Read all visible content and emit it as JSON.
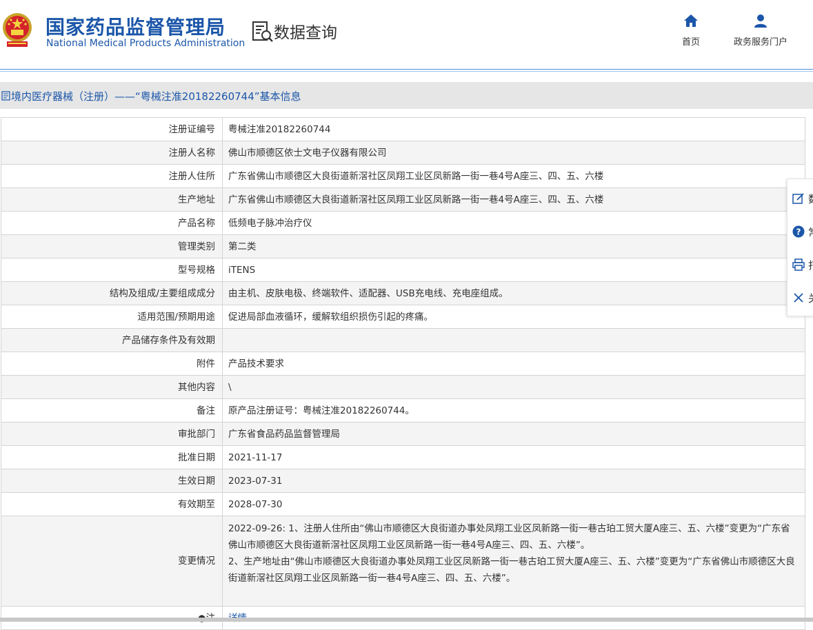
{
  "header": {
    "agency_cn": "国家药品监督管理局",
    "agency_en": "National Medical Products Administration",
    "section_title": "数据查询",
    "nav": [
      {
        "label": "首页",
        "icon": "home-icon"
      },
      {
        "label": "政务服务门户",
        "icon": "user-icon"
      }
    ]
  },
  "page_title": "境内医疗器械（注册）——“粤械注准20182260744”基本信息",
  "rows": [
    {
      "label": "注册证编号",
      "value": "粤械注准20182260744"
    },
    {
      "label": "注册人名称",
      "value": "佛山市顺德区依士文电子仪器有限公司"
    },
    {
      "label": "注册人住所",
      "value": "广东省佛山市顺德区大良街道新滘社区凤翔工业区凤新路一街一巷4号A座三、四、五、六楼"
    },
    {
      "label": "生产地址",
      "value": "广东省佛山市顺德区大良街道新滘社区凤翔工业区凤新路一街一巷4号A座三、四、五、六楼"
    },
    {
      "label": "产品名称",
      "value": "低频电子脉冲治疗仪"
    },
    {
      "label": "管理类别",
      "value": "第二类"
    },
    {
      "label": "型号规格",
      "value": "iTENS"
    },
    {
      "label": "结构及组成/主要组成成分",
      "value": "由主机、皮肤电极、终端软件、适配器、USB充电线、充电座组成。"
    },
    {
      "label": "适用范围/预期用途",
      "value": "促进局部血液循环，缓解软组织损伤引起的疼痛。"
    },
    {
      "label": "产品储存条件及有效期",
      "value": ""
    },
    {
      "label": "附件",
      "value": "产品技术要求"
    },
    {
      "label": "其他内容",
      "value": "\\"
    },
    {
      "label": "备注",
      "value": "原产品注册证号：粤械注准20182260744。"
    },
    {
      "label": "审批部门",
      "value": "广东省食品药品监督管理局"
    },
    {
      "label": "批准日期",
      "value": "2021-11-17"
    },
    {
      "label": "生效日期",
      "value": "2023-07-31"
    },
    {
      "label": "有效期至",
      "value": "2028-07-30"
    }
  ],
  "change": {
    "label": "变更情况",
    "line1": "2022-09-26: 1、注册人住所由“佛山市顺德区大良街道办事处凤翔工业区凤新路一街一巷古珀工贸大厦A座三、五、六楼”变更为“广东省佛山市顺德区大良街道新滘社区凤翔工业区凤新路一街一巷4号A座三、四、五、六楼”。",
    "line2": "2、生产地址由“佛山市顺德区大良街道办事处凤翔工业区凤新路一街一巷古珀工贸大厦A座三、五、六楼”变更为“广东省佛山市顺德区大良街道新滘社区凤翔工业区凤新路一街一巷4号A座三、四、五、六楼”。"
  },
  "last_row": {
    "label": "●注",
    "value": "详情"
  },
  "sidebar": [
    {
      "label": "数",
      "icon": "edit-icon"
    },
    {
      "label": "常",
      "icon": "help-icon"
    },
    {
      "label": "打",
      "icon": "print-icon"
    },
    {
      "label": "关",
      "icon": "close-icon"
    }
  ],
  "colors": {
    "brand_blue": "#1b56a9",
    "title_bar": "#e6e6e6",
    "row_alt": "#f4f4f4"
  }
}
